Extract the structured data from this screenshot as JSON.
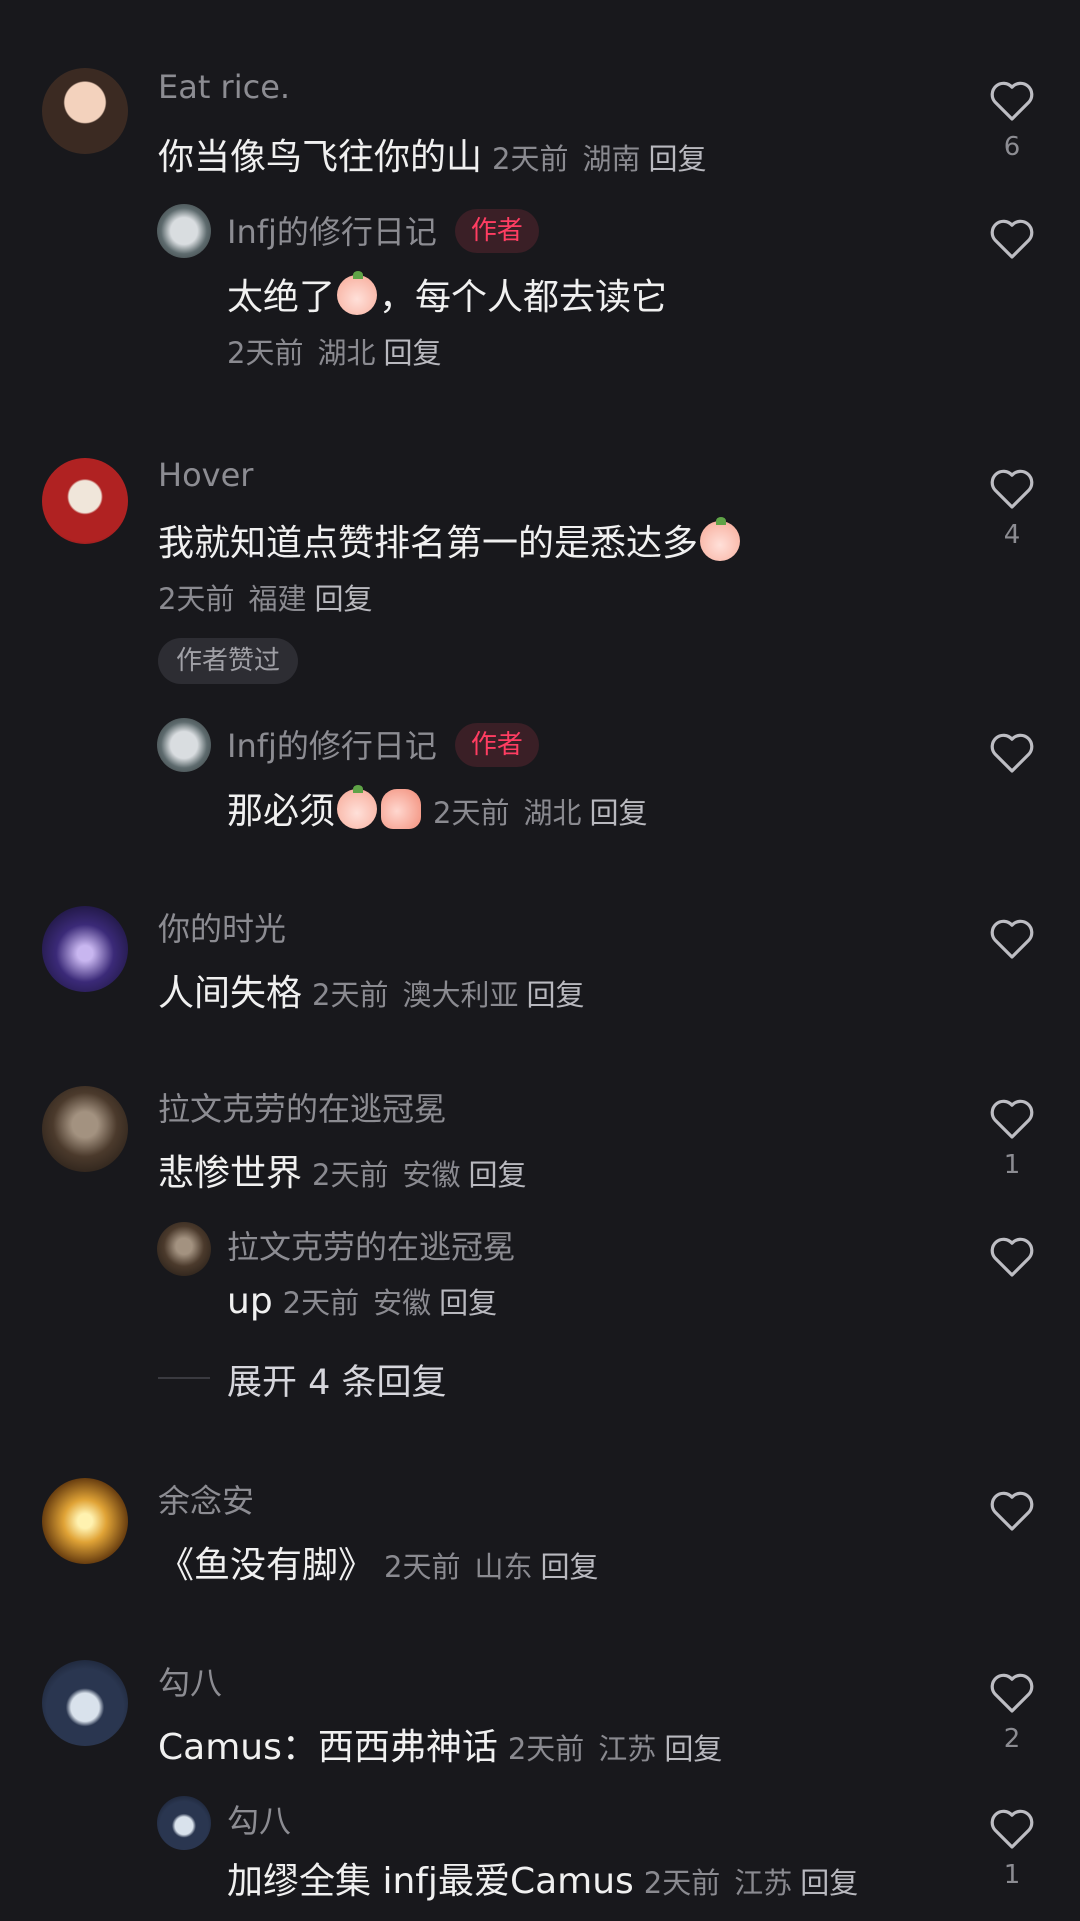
{
  "comments": [
    {
      "user": "Eat rice.",
      "text": "你当像鸟飞往你的山",
      "time": "2天前",
      "location": "湖南",
      "reply_label": "回复",
      "likes": "6",
      "replies": [
        {
          "user": "Infj的修行日记",
          "badge": "作者",
          "text_before": "太绝了",
          "text_after": "，每个人都去读它",
          "time": "2天前",
          "location": "湖北",
          "reply_label": "回复"
        }
      ]
    },
    {
      "user": "Hover",
      "text": "我就知道点赞排名第一的是悉达多",
      "time": "2天前",
      "location": "福建",
      "reply_label": "回复",
      "likes": "4",
      "liked_badge": "作者赞过",
      "replies": [
        {
          "user": "Infj的修行日记",
          "badge": "作者",
          "text": "那必须",
          "time": "2天前",
          "location": "湖北",
          "reply_label": "回复"
        }
      ]
    },
    {
      "user": "你的时光",
      "text": "人间失格",
      "time": "2天前",
      "location": "澳大利亚",
      "reply_label": "回复"
    },
    {
      "user": "拉文克劳的在逃冠冕",
      "text": "悲惨世界",
      "time": "2天前",
      "location": "安徽",
      "reply_label": "回复",
      "likes": "1",
      "replies": [
        {
          "user": "拉文克劳的在逃冠冕",
          "text": "up",
          "time": "2天前",
          "location": "安徽",
          "reply_label": "回复"
        }
      ],
      "expand_label": "展开 4 条回复"
    },
    {
      "user": "余念安",
      "text": "《鱼没有脚》",
      "time": "2天前",
      "location": "山东",
      "reply_label": "回复"
    },
    {
      "user": "勾八",
      "text": "Camus：西西弗神话",
      "time": "2天前",
      "location": "江苏",
      "reply_label": "回复",
      "likes": "2",
      "replies": [
        {
          "user": "勾八",
          "text": "加缪全集 infj最爱Camus",
          "time": "2天前",
          "location": "江苏",
          "reply_label": "回复",
          "likes": "1"
        }
      ]
    }
  ],
  "icons": {
    "like": "heart-outline-icon",
    "emoji": "peach-face-emoji",
    "thumb": "thumbs-up-emoji"
  },
  "colors": {
    "background": "#18181c",
    "author_badge_text": "#ff3d62",
    "author_badge_bg": "#3a1f26"
  }
}
